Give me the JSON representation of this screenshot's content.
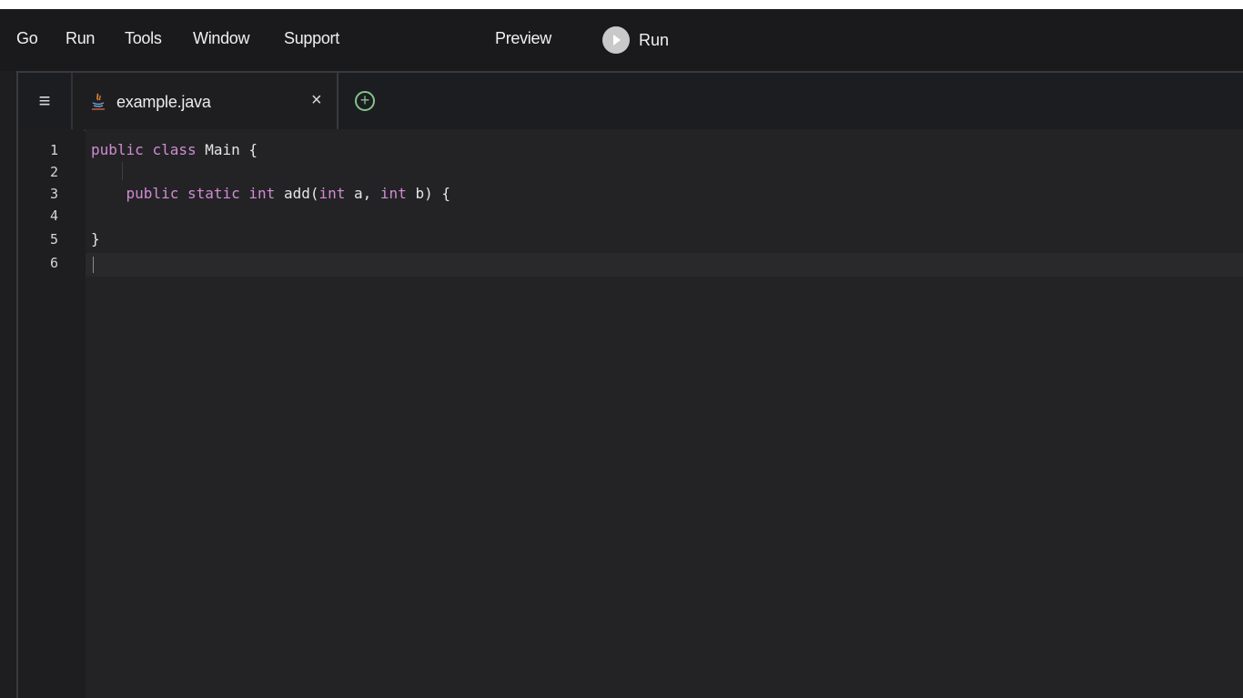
{
  "menu": {
    "items": [
      "Go",
      "Run",
      "Tools",
      "Window",
      "Support"
    ],
    "preview_label": "Preview",
    "run_label": "Run"
  },
  "tabs": {
    "active_file": "example.java",
    "close_symbol": "×",
    "add_symbol": "+"
  },
  "editor": {
    "line_numbers": [
      "1",
      "2",
      "3",
      "4",
      "5",
      "6"
    ],
    "lines": [
      {
        "parts": [
          {
            "t": "public",
            "k": true
          },
          {
            "t": " ",
            "k": false
          },
          {
            "t": "class",
            "k": true
          },
          {
            "t": " Main {",
            "k": false
          }
        ]
      },
      {
        "parts": []
      },
      {
        "parts": [
          {
            "t": "    ",
            "k": false
          },
          {
            "t": "public",
            "k": true
          },
          {
            "t": " ",
            "k": false
          },
          {
            "t": "static",
            "k": true
          },
          {
            "t": " ",
            "k": false
          },
          {
            "t": "int",
            "k": true
          },
          {
            "t": " add(",
            "k": false
          },
          {
            "t": "int",
            "k": true
          },
          {
            "t": " a, ",
            "k": false
          },
          {
            "t": "int",
            "k": true
          },
          {
            "t": " b) {",
            "k": false
          }
        ]
      },
      {
        "parts": []
      },
      {
        "parts": [
          {
            "t": "}",
            "k": false
          }
        ]
      },
      {
        "parts": []
      }
    ],
    "colors": {
      "keyword": "#d08cd3",
      "text": "#e6e6e6",
      "add_icon": "#86c389"
    }
  }
}
